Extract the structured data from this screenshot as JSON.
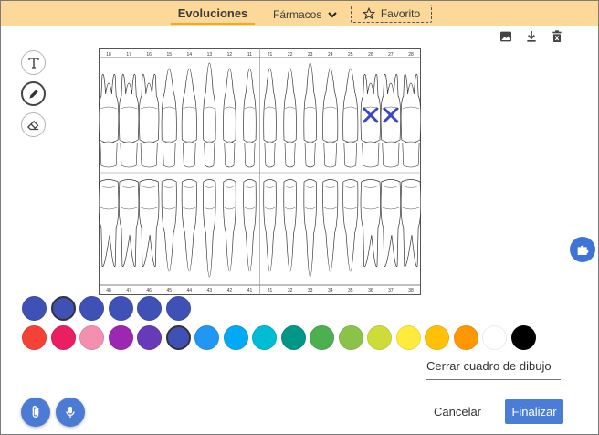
{
  "tabs": {
    "evoluciones": "Evoluciones",
    "farmacos": "Fármacos",
    "favorito": "Favorito"
  },
  "odontogram": {
    "upper_numbers": [
      "18",
      "17",
      "16",
      "15",
      "14",
      "13",
      "12",
      "11",
      "21",
      "22",
      "23",
      "24",
      "25",
      "26",
      "27",
      "28"
    ],
    "lower_numbers": [
      "48",
      "47",
      "46",
      "45",
      "44",
      "43",
      "42",
      "41",
      "31",
      "32",
      "33",
      "34",
      "35",
      "36",
      "37",
      "38"
    ],
    "marked_teeth": [
      "26",
      "27"
    ],
    "mark_color": "#3a47c5"
  },
  "palette": {
    "row1": [
      "#3f51b5",
      "#3f51b5",
      "#3f51b5",
      "#3f51b5",
      "#3f51b5",
      "#3f51b5"
    ],
    "row2": [
      "#f44336",
      "#e91e63",
      "#f48fb1",
      "#9c27b0",
      "#673ab7",
      "#3f51b5",
      "#2196f3",
      "#03a9f4",
      "#00bcd4",
      "#009688",
      "#4caf50",
      "#8bc34a",
      "#cddc39",
      "#ffeb3b",
      "#ffc107",
      "#ff9800",
      "#ffffff",
      "#000000"
    ],
    "selected_row1_index": 1,
    "selected_row2_index": 5
  },
  "actions": {
    "close_drawing": "Cerrar cuadro de dibujo",
    "cancel": "Cancelar",
    "finish": "Finalizar"
  },
  "colors": {
    "topbar": "#fcd999",
    "accent_tab": "#f5a623",
    "primary": "#4a7ed6"
  }
}
